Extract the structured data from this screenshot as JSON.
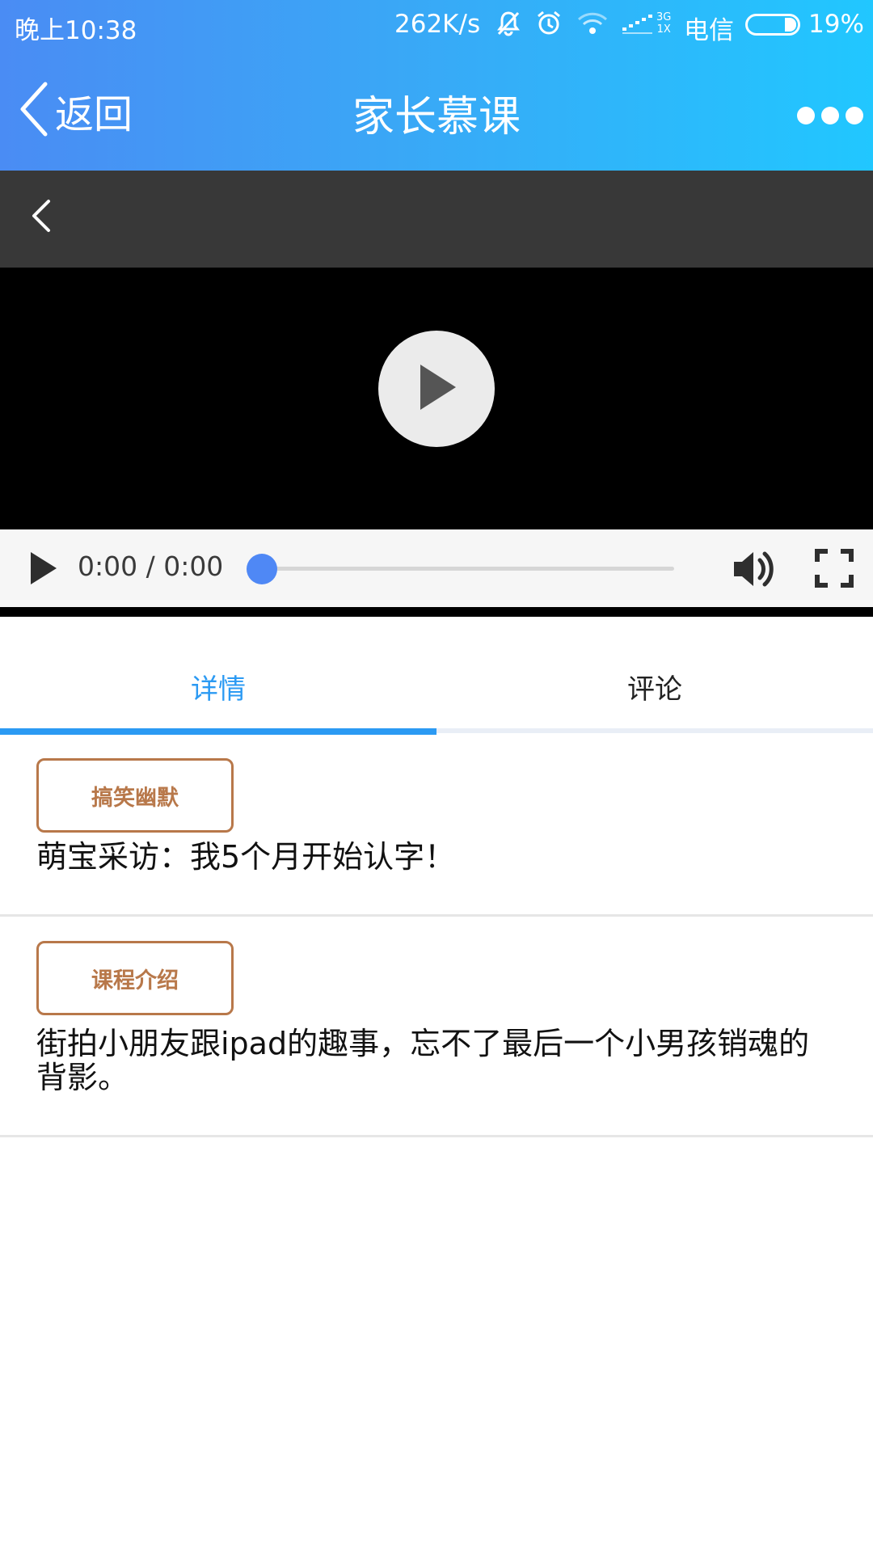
{
  "status_bar": {
    "time": "晚上10:38",
    "speed": "262K/s",
    "network_top": "3G",
    "network_bottom": "1X",
    "carrier": "电信",
    "battery": "19%"
  },
  "nav": {
    "back_label": "返回",
    "title": "家长慕课"
  },
  "player": {
    "time_display": "0:00 / 0:00",
    "progress": 0
  },
  "tabs": [
    {
      "label": "详情",
      "active": true
    },
    {
      "label": "评论",
      "active": false
    }
  ],
  "sections": [
    {
      "tag": "搞笑幽默",
      "text": "萌宝采访：我5个月开始认字！"
    },
    {
      "tag": "课程介绍",
      "text": "街拍小朋友跟ipad的趣事，忘不了最后一个小男孩销魂的背影。"
    }
  ],
  "colors": {
    "accent": "#2b9af3",
    "tag": "#b8784a",
    "seek_thumb": "#4f88f5"
  }
}
